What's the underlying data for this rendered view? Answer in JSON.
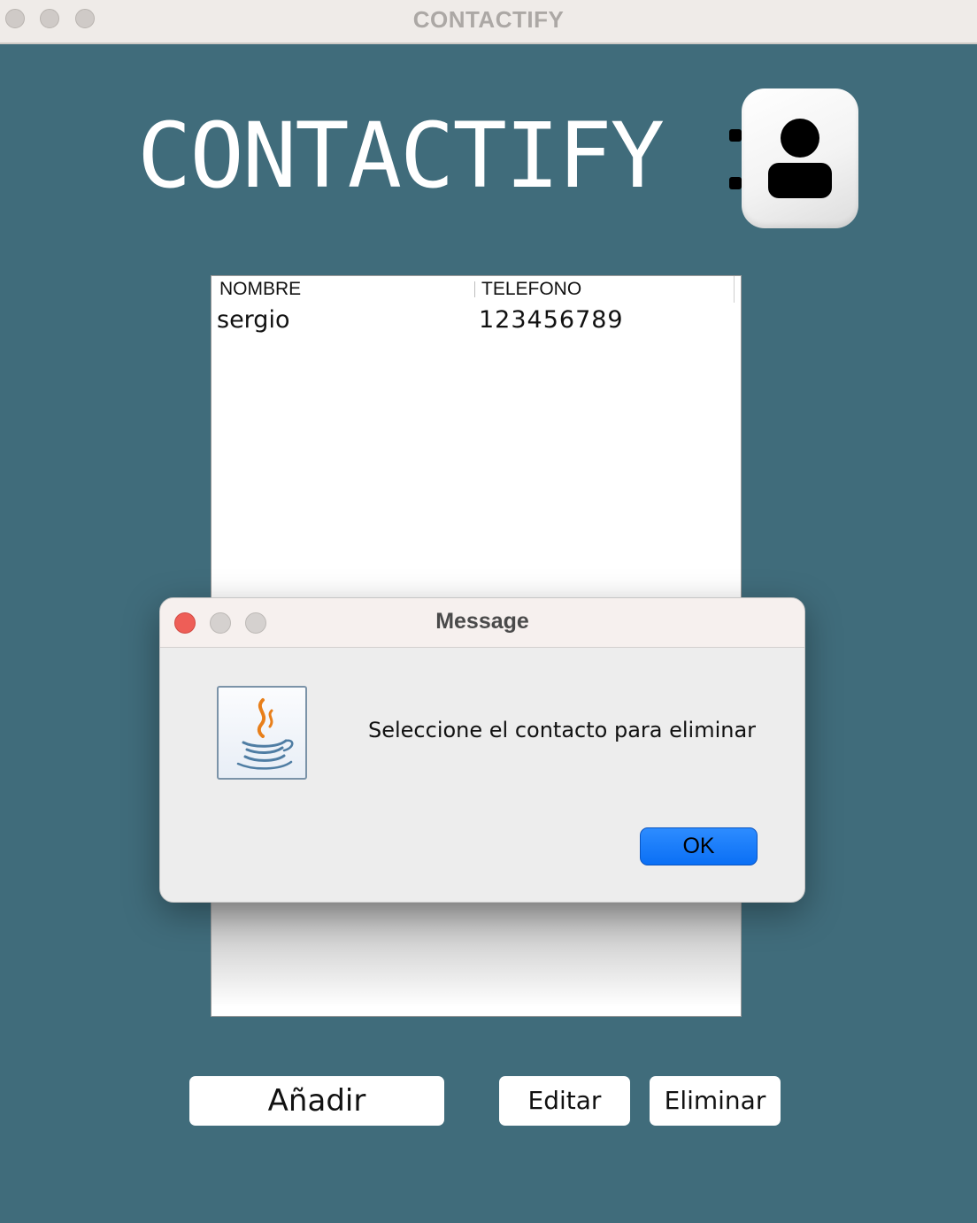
{
  "window": {
    "title": "CONTACTIFY"
  },
  "header": {
    "title": "CONTACTIFY",
    "logo_icon": "user-contact-icon"
  },
  "table": {
    "columns": [
      "NOMBRE",
      "TELEFONO"
    ],
    "rows": [
      {
        "nombre": "sergio",
        "telefono": "123456789"
      }
    ]
  },
  "dialog": {
    "title": "Message",
    "icon": "java-icon",
    "message": "Seleccione el contacto para eliminar",
    "ok_label": "OK"
  },
  "actions": {
    "add_label": "Añadir",
    "edit_label": "Editar",
    "delete_label": "Eliminar"
  },
  "colors": {
    "background": "#406c7b",
    "ok_button": "#1a7cfa",
    "close_red": "#ee5e57"
  }
}
